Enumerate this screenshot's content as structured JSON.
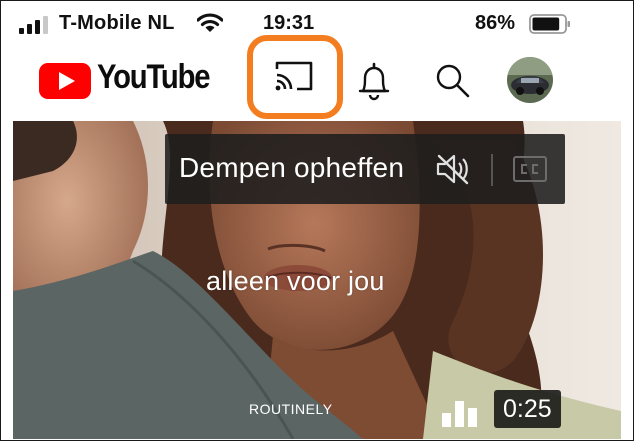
{
  "status_bar": {
    "carrier": "T-Mobile NL",
    "time": "19:31",
    "battery_percent": "86%",
    "battery_level": 0.86,
    "signal_bars": 3,
    "icons": [
      "signal-icon",
      "wifi-icon",
      "battery-icon"
    ]
  },
  "header": {
    "logo_text": "YouTube",
    "icons": [
      "cast-icon",
      "bell-icon",
      "search-icon",
      "avatar"
    ],
    "highlight_color": "#f47d20",
    "brand_color": "#ff0000"
  },
  "video": {
    "mute_label": "Dempen opheffen",
    "caption": "alleen voor jou",
    "brand": "ROUTINELY",
    "duration": "0:25",
    "icons": [
      "muted-speaker-icon",
      "closed-captions-icon",
      "stats-icon"
    ]
  }
}
